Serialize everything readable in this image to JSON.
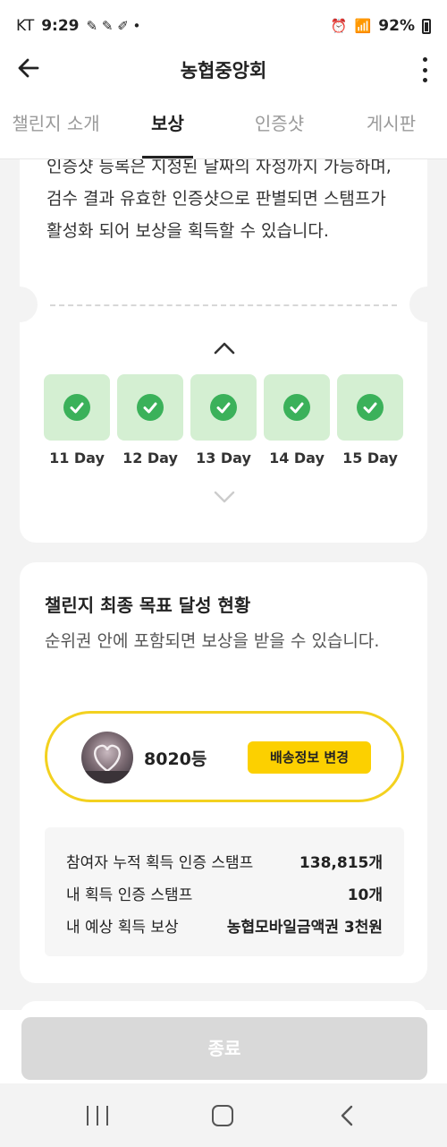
{
  "status": {
    "carrier": "KT",
    "time": "9:29",
    "battery": "92%"
  },
  "appbar": {
    "title": "농협중앙회"
  },
  "tabs": [
    {
      "label": "챌린지 소개",
      "active": false
    },
    {
      "label": "보상",
      "active": true
    },
    {
      "label": "인증샷",
      "active": false
    },
    {
      "label": "게시판",
      "active": false
    }
  ],
  "reward_card": {
    "description": "인증샷 등록은 지정된 날짜의 자정까지 가능하며, 검수 결과 유효한 인증샷으로 판별되면 스탬프가 활성화 되어 보상을 획득할 수 있습니다.",
    "days": [
      {
        "label": "11 Day",
        "completed": true
      },
      {
        "label": "12 Day",
        "completed": true
      },
      {
        "label": "13 Day",
        "completed": true
      },
      {
        "label": "14 Day",
        "completed": true
      },
      {
        "label": "15 Day",
        "completed": true
      }
    ]
  },
  "goal_card": {
    "title": "챌린지 최종 목표 달성 현황",
    "subtitle": "순위권 안에 포함되면 보상을 받을 수 있습니다.",
    "rank": "8020등",
    "shipping_button": "배송정보 변경",
    "stats": [
      {
        "label": "참여자 누적 획득 인증 스탬프",
        "value": "138,815개"
      },
      {
        "label": "내 획득 인증 스탬프",
        "value": "10개"
      },
      {
        "label": "내 예상 획득 보상",
        "value": "농협모바일금액권 3천원"
      }
    ]
  },
  "footer": {
    "end_button": "종료"
  },
  "colors": {
    "accent_yellow": "#fcd000",
    "check_green": "#3bb15a",
    "day_bg": "#d4efd2"
  }
}
